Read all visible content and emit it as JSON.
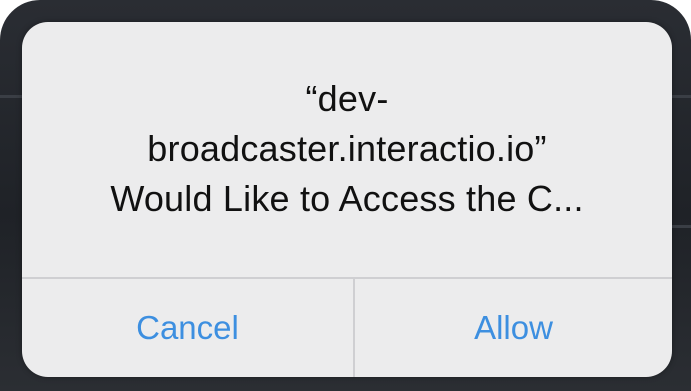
{
  "alert": {
    "message_lines": [
      "“dev-",
      "broadcaster.interactio.io”",
      "Would Like to Access the C..."
    ],
    "cancel_label": "Cancel",
    "allow_label": "Allow",
    "accent_color": "#3d8fe0"
  }
}
